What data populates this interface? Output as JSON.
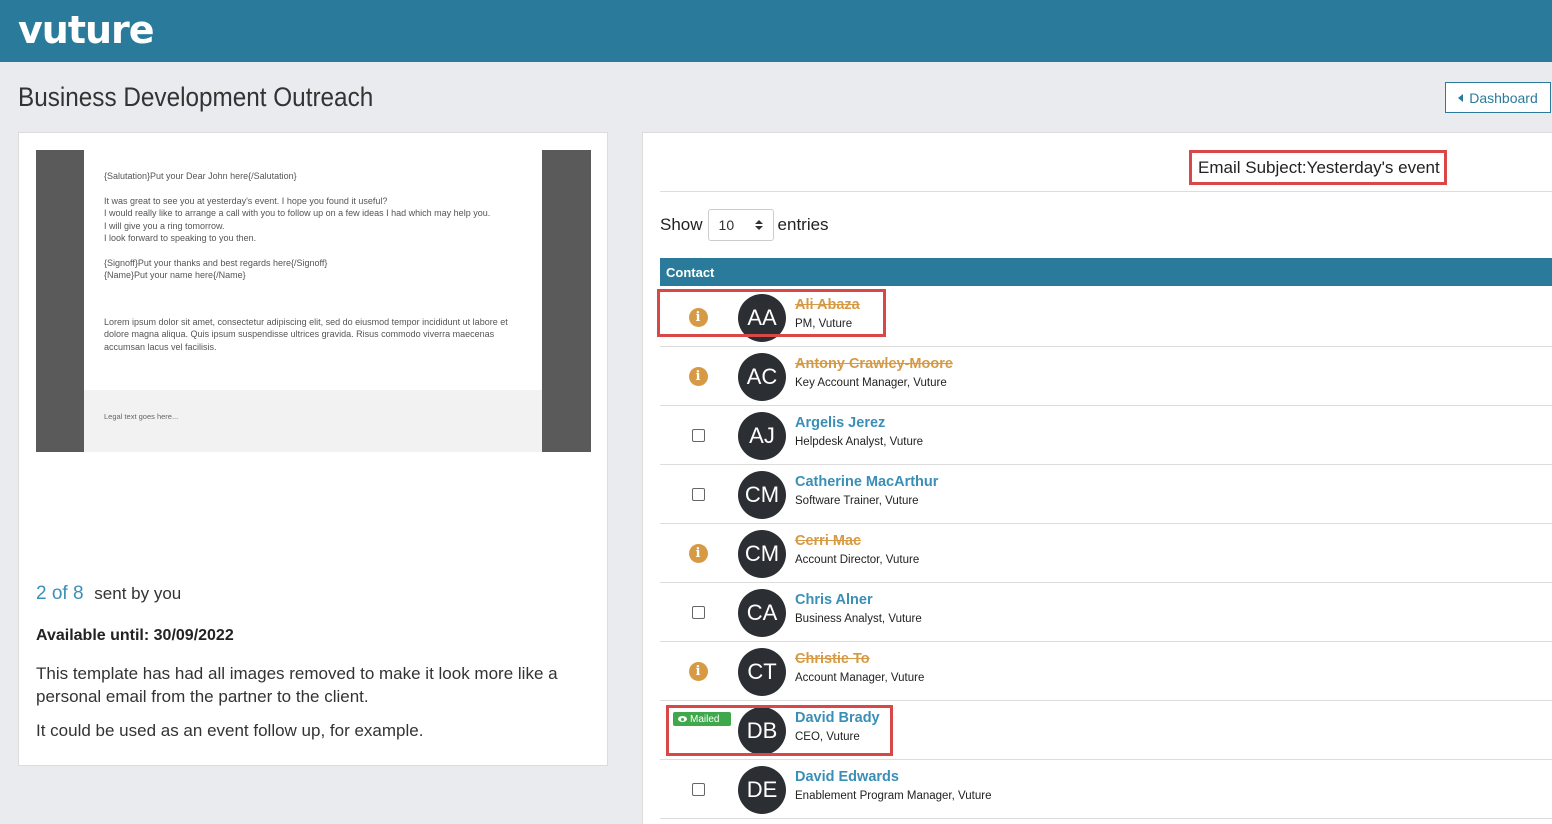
{
  "app": {
    "logo": "vuture"
  },
  "header": {
    "title": "Business Development Outreach",
    "dashboard_label": "Dashboard"
  },
  "template": {
    "preview": {
      "salutation": "{Salutation}Put your Dear John here{/Salutation}",
      "para1": "It was great to see you at yesterday's event.  I hope you found it useful?\nI would really like to arrange a call with you to follow up on a few ideas I had which may help you.\nI will give you a ring tomorrow.\nI look forward to speaking to you then.",
      "signoff": "{Signoff}Put your thanks and best regards here{/Signoff}\n{Name}Put your name here{/Name}",
      "lorem": "Lorem ipsum dolor sit amet, consectetur adipiscing elit, sed do eiusmod tempor incididunt ut labore et dolore magna aliqua. Quis ipsum suspendisse ultrices gravida. Risus commodo viverra maecenas accumsan lacus vel facilisis.",
      "legal": "Legal text goes here..."
    },
    "sent_count": "2 of 8",
    "sent_suffix": "sent by you",
    "available_until": "Available until: 30/09/2022",
    "description_1": "This template has had all images removed to make it look more like a personal email from the partner to the client.",
    "description_2": "It could be used as an event follow up, for example."
  },
  "email": {
    "subject_label": "Email Subject:",
    "subject_value": "Yesterday's event"
  },
  "table": {
    "show_label": "Show",
    "page_size": "10",
    "entries_label": "entries",
    "column_header": "Contact",
    "contacts": [
      {
        "initials": "AA",
        "name": "Ali Abaza",
        "role": "PM, Vuture",
        "status": "info"
      },
      {
        "initials": "AC",
        "name": "Antony Crawley-Moore",
        "role": "Key Account Manager, Vuture",
        "status": "info"
      },
      {
        "initials": "AJ",
        "name": "Argelis Jerez",
        "role": "Helpdesk Analyst, Vuture",
        "status": "checkbox"
      },
      {
        "initials": "CM",
        "name": "Catherine MacArthur",
        "role": "Software Trainer, Vuture",
        "status": "checkbox"
      },
      {
        "initials": "CM",
        "name": "Cerri Mac",
        "role": "Account Director, Vuture",
        "status": "info"
      },
      {
        "initials": "CA",
        "name": "Chris Alner",
        "role": "Business Analyst, Vuture",
        "status": "checkbox"
      },
      {
        "initials": "CT",
        "name": "Christie To",
        "role": "Account Manager, Vuture",
        "status": "info"
      },
      {
        "initials": "DB",
        "name": "David Brady",
        "role": "CEO, Vuture",
        "status": "mailed",
        "badge": "Mailed"
      },
      {
        "initials": "DE",
        "name": "David Edwards",
        "role": "Enablement Program Manager, Vuture",
        "status": "checkbox"
      }
    ]
  },
  "colors": {
    "brand": "#2a7b9b",
    "link": "#3a8fb7",
    "warning": "#d69a45",
    "mailed": "#3ea84a",
    "highlight": "#d94848"
  }
}
